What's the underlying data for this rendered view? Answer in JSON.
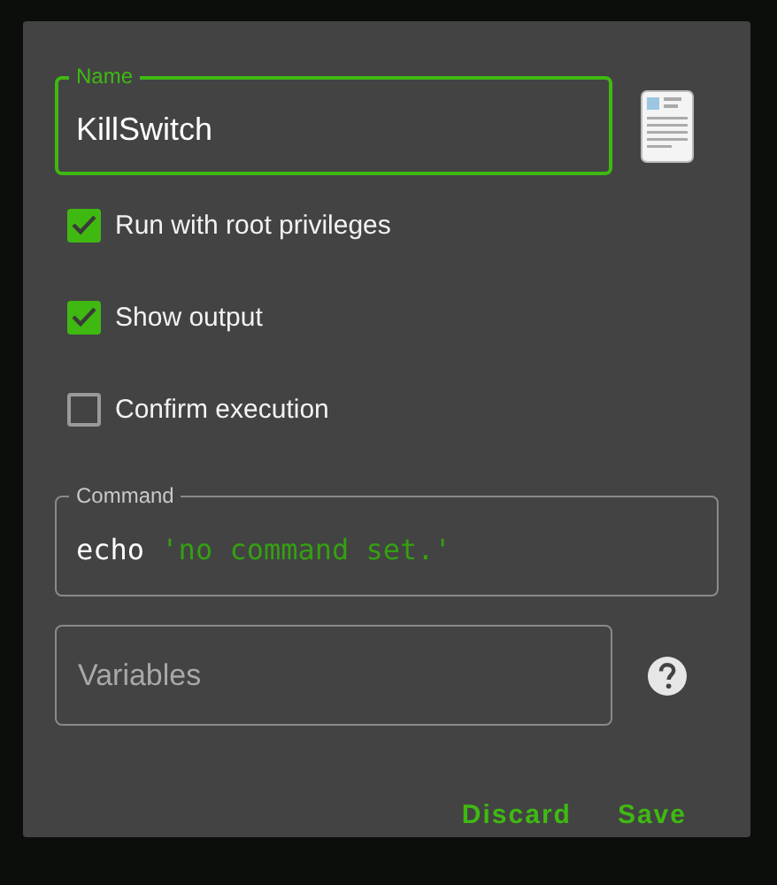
{
  "name_field": {
    "label": "Name",
    "value": "KillSwitch",
    "focused": true
  },
  "options": [
    {
      "label": "Run with root privileges",
      "checked": true
    },
    {
      "label": "Show output",
      "checked": true
    },
    {
      "label": "Confirm execution",
      "checked": false
    }
  ],
  "command_field": {
    "label": "Command",
    "value_parts": [
      {
        "text": "echo",
        "kind": "keyword"
      },
      {
        "text": "'no command set.'",
        "kind": "string"
      }
    ]
  },
  "variables_field": {
    "placeholder": "Variables"
  },
  "buttons": [
    "Discard",
    "Save"
  ]
}
